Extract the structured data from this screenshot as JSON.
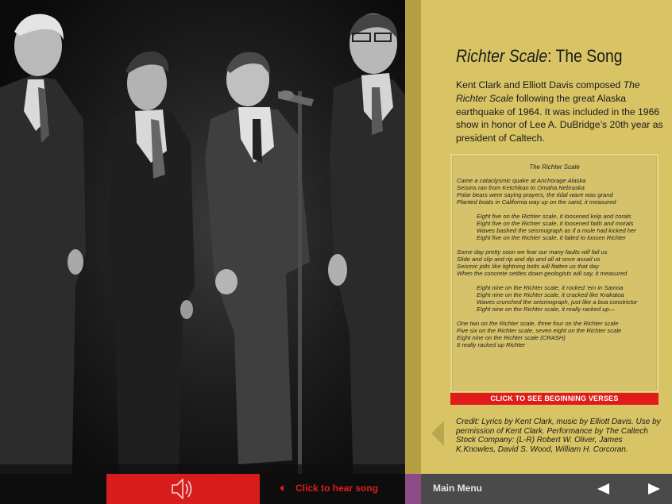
{
  "page": {
    "title_italic": "Richter Scale",
    "title_rest": ":  The Song",
    "intro": {
      "part1": "Kent Clark and Elliott Davis composed ",
      "song_italic": "The Richter Scale",
      "part2": " following the great Alaska earthquake of 1964. It was included in the 1966 show in honor of Lee A. DuBridge’s 20th year as president of Caltech."
    }
  },
  "lyrics": {
    "title": "The Richter Scale",
    "verse1": [
      "Came a cataclysmic quake at Anchorage Alaska",
      "Seisms ran from Ketchikan to Omaha Nebraska",
      "Polar bears were saying prayers, the tidal wave was grand",
      "Planted boats in California way up on the sand, it measured"
    ],
    "chorus1": [
      "Eight five on the Richter scale, it loosened kelp and corals",
      "Eight five on the Richter scale, it loosened faith and morals",
      "Waves bashed the seismograph as if a mule had kicked her",
      "Eight five on the Richter scale, it failed to loosen Richter"
    ],
    "verse2": [
      "Some day pretty soon we fear our many faults will fail us",
      "Slide and slip and rip and dip and all at once assail us",
      "Seismic jolts like lightning bolts will flatten us that day",
      "When the concrete settles down geologists will say, it measured"
    ],
    "chorus2": [
      "Eight nine on the Richter scale, it rocked ’em in Samoa",
      "Eight nine on the Richter scale, it cracked like Krakatoa",
      "Waves crunched the seismograph, just like a boa constrictor",
      "Eight nine on the Richter scale, it really racked up—"
    ],
    "ending": [
      "One two on the Richter scale, three four on the Richter scale",
      "Five six on the Richter scale, seven eight on the Richter scale",
      "Eight nine on the Richter scale (CRASH)",
      "It really racked up Richter"
    ]
  },
  "verses_button": "CLICK TO SEE BEGINNING VERSES",
  "credit": "Credit:  Lyrics by Kent Clark, music by Elliott Davis. Use by permission of Kent Clark.  Performance by The Caltech Stock Company: (L-R) Robert W. Oliver, James K.Knowles, David S. Wood, William H. Corcoran.",
  "bottom_bar": {
    "audio_icon": "speaker-icon",
    "hear_song": "Click to hear song",
    "main_menu": "Main Menu",
    "prev_icon": "prev-arrow-icon",
    "next_icon": "next-arrow-icon"
  },
  "colors": {
    "panel": "#d8c465",
    "accent_red": "#e11b1b",
    "divider": "#b4a043",
    "purple": "#8c4b86",
    "nav_gray": "#4a4a4a"
  }
}
